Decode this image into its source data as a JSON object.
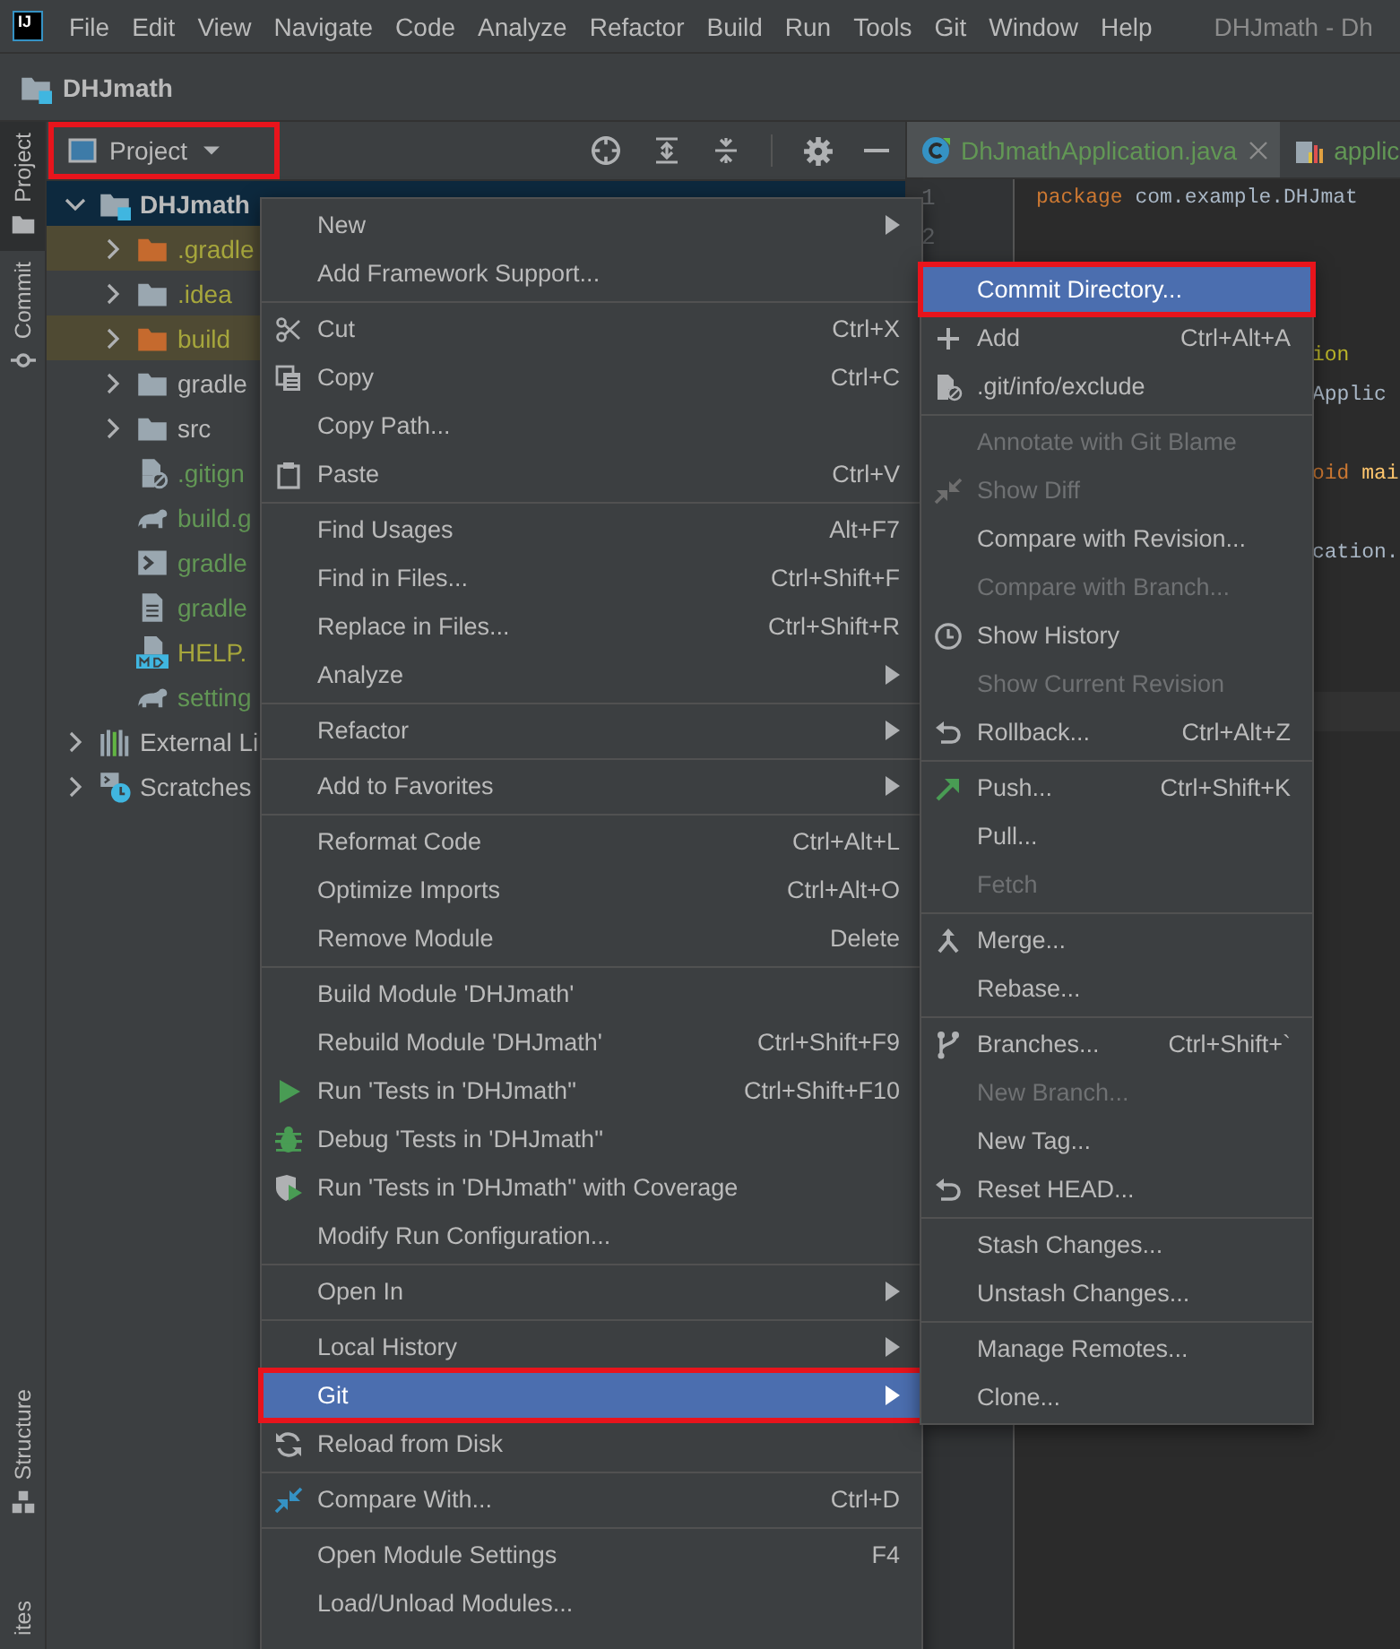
{
  "menu_bar": {
    "logo": "IJ",
    "items": [
      "File",
      "Edit",
      "View",
      "Navigate",
      "Code",
      "Analyze",
      "Refactor",
      "Build",
      "Run",
      "Tools",
      "Git",
      "Window",
      "Help"
    ],
    "title": "DHJmath - Dh"
  },
  "nav_bar": {
    "project": "DHJmath"
  },
  "tool_strip": {
    "top": [
      {
        "label": "Project",
        "kind": "project",
        "selected": true
      },
      {
        "label": "Commit",
        "kind": "commit",
        "selected": false
      }
    ],
    "bottom": [
      {
        "label": "Structure",
        "kind": "structure"
      },
      {
        "label": "ites",
        "kind": "favorites"
      }
    ]
  },
  "project_panel": {
    "view": {
      "label": "Project",
      "marked": true
    },
    "tree": [
      {
        "label": "DHJmath",
        "kind": "module",
        "color": "#bbbbbb",
        "selected": true,
        "excluded": false,
        "expanded": true,
        "children": [
          {
            "label": ".gradle",
            "kind": "folder",
            "color": "#a6a63c",
            "selected": false,
            "excluded": true,
            "expanded": false
          },
          {
            "label": ".idea",
            "kind": "folder",
            "color": "#a6a63c",
            "selected": false,
            "excluded": false,
            "expanded": false
          },
          {
            "label": "build",
            "kind": "folder",
            "color": "#a6a63c",
            "selected": false,
            "excluded": true,
            "expanded": false
          },
          {
            "label": "gradle",
            "kind": "folder",
            "color": "#bbbbbb",
            "selected": false,
            "excluded": false,
            "expanded": false
          },
          {
            "label": "src",
            "kind": "folder",
            "color": "#bbbbbb",
            "selected": false,
            "excluded": false,
            "expanded": false
          },
          {
            "label": ".gitign",
            "kind": "ignore-file",
            "color": "#629755",
            "selected": false,
            "excluded": false
          },
          {
            "label": "build.g",
            "kind": "gradle-script",
            "color": "#629755",
            "selected": false,
            "excluded": false
          },
          {
            "label": "gradle",
            "kind": "shell-script",
            "color": "#629755",
            "selected": false,
            "excluded": false
          },
          {
            "label": "gradle",
            "kind": "text-file",
            "color": "#629755",
            "selected": false,
            "excluded": false
          },
          {
            "label": "HELP.",
            "kind": "markdown-file",
            "color": "#a6a63c",
            "selected": false,
            "excluded": false
          },
          {
            "label": "setting",
            "kind": "gradle-script",
            "color": "#629755",
            "selected": false,
            "excluded": false
          }
        ]
      },
      {
        "label": "External Li",
        "kind": "libraries",
        "color": "#bbbbbb",
        "selected": false,
        "excluded": false,
        "expanded": false
      },
      {
        "label": "Scratches",
        "kind": "scratches",
        "color": "#bbbbbb",
        "selected": false,
        "excluded": false,
        "expanded": false
      }
    ]
  },
  "editor": {
    "tabs": [
      {
        "label": "DhJmathApplication.java",
        "kind": "class",
        "selected": true,
        "closable": true
      },
      {
        "label": "applic",
        "kind": "properties",
        "selected": false,
        "closable": false
      }
    ],
    "line_numbers": [
      "1",
      "2"
    ],
    "lines": [
      {
        "kind": "full",
        "tokens": [
          {
            "text": "package",
            "kind": "keyword"
          },
          {
            "text": " com.example.DHJmat",
            "kind": "plain"
          }
        ]
      },
      {
        "kind": "blank"
      },
      {
        "kind": "blank"
      },
      {
        "kind": "blank"
      },
      {
        "kind": "clipped",
        "tokens": [
          {
            "text": "ion",
            "kind": "annotation"
          }
        ]
      },
      {
        "kind": "clipped",
        "tokens": [
          {
            "text": "Applic",
            "kind": "plain"
          }
        ]
      },
      {
        "kind": "blank"
      },
      {
        "kind": "clipped",
        "tokens": [
          {
            "text": "oid",
            "kind": "keyword"
          },
          {
            "text": " mai",
            "kind": "method"
          }
        ]
      },
      {
        "kind": "blank"
      },
      {
        "kind": "clipped",
        "tokens": [
          {
            "text": "cation.",
            "kind": "plain"
          }
        ]
      },
      {
        "kind": "blank"
      },
      {
        "kind": "blank"
      },
      {
        "kind": "blank"
      },
      {
        "kind": "current"
      }
    ]
  },
  "context_menu": {
    "items": [
      {
        "kind": "item",
        "label": "New",
        "submenu": true,
        "selected": false,
        "marked": false
      },
      {
        "kind": "item",
        "label": "Add Framework Support...",
        "submenu": false,
        "selected": false,
        "marked": false
      },
      {
        "kind": "separator"
      },
      {
        "kind": "cut",
        "label": "Cut",
        "shortcut": "Ctrl+X",
        "submenu": false,
        "selected": false,
        "marked": false
      },
      {
        "kind": "copy",
        "label": "Copy",
        "shortcut": "Ctrl+C",
        "submenu": false,
        "selected": false,
        "marked": false
      },
      {
        "kind": "item",
        "label": "Copy Path...",
        "submenu": false,
        "selected": false,
        "marked": false
      },
      {
        "kind": "paste",
        "label": "Paste",
        "shortcut": "Ctrl+V",
        "submenu": false,
        "selected": false,
        "marked": false
      },
      {
        "kind": "separator"
      },
      {
        "kind": "item",
        "label": "Find Usages",
        "shortcut": "Alt+F7",
        "submenu": false,
        "selected": false,
        "marked": false
      },
      {
        "kind": "item",
        "label": "Find in Files...",
        "shortcut": "Ctrl+Shift+F",
        "submenu": false,
        "selected": false,
        "marked": false
      },
      {
        "kind": "item",
        "label": "Replace in Files...",
        "shortcut": "Ctrl+Shift+R",
        "submenu": false,
        "selected": false,
        "marked": false
      },
      {
        "kind": "item",
        "label": "Analyze",
        "submenu": true,
        "selected": false,
        "marked": false
      },
      {
        "kind": "separator"
      },
      {
        "kind": "item",
        "label": "Refactor",
        "submenu": true,
        "selected": false,
        "marked": false
      },
      {
        "kind": "separator"
      },
      {
        "kind": "item",
        "label": "Add to Favorites",
        "submenu": true,
        "selected": false,
        "marked": false
      },
      {
        "kind": "separator"
      },
      {
        "kind": "item",
        "label": "Reformat Code",
        "shortcut": "Ctrl+Alt+L",
        "submenu": false,
        "selected": false,
        "marked": false
      },
      {
        "kind": "item",
        "label": "Optimize Imports",
        "shortcut": "Ctrl+Alt+O",
        "submenu": false,
        "selected": false,
        "marked": false
      },
      {
        "kind": "item",
        "label": "Remove Module",
        "shortcut": "Delete",
        "submenu": false,
        "selected": false,
        "marked": false
      },
      {
        "kind": "separator"
      },
      {
        "kind": "item",
        "label": "Build Module 'DHJmath'",
        "submenu": false,
        "selected": false,
        "marked": false
      },
      {
        "kind": "item",
        "label": "Rebuild Module 'DHJmath'",
        "shortcut": "Ctrl+Shift+F9",
        "submenu": false,
        "selected": false,
        "marked": false
      },
      {
        "kind": "run",
        "label": "Run 'Tests in 'DHJmath''",
        "shortcut": "Ctrl+Shift+F10",
        "submenu": false,
        "selected": false,
        "marked": false
      },
      {
        "kind": "debug",
        "label": "Debug 'Tests in 'DHJmath''",
        "submenu": false,
        "selected": false,
        "marked": false
      },
      {
        "kind": "coverage",
        "label": "Run 'Tests in 'DHJmath'' with Coverage",
        "submenu": false,
        "selected": false,
        "marked": false
      },
      {
        "kind": "item",
        "label": "Modify Run Configuration...",
        "submenu": false,
        "selected": false,
        "marked": false
      },
      {
        "kind": "separator"
      },
      {
        "kind": "item",
        "label": "Open In",
        "submenu": true,
        "selected": false,
        "marked": false
      },
      {
        "kind": "separator"
      },
      {
        "kind": "item",
        "label": "Local History",
        "submenu": true,
        "selected": false,
        "marked": false
      },
      {
        "kind": "item",
        "label": "Git",
        "submenu": true,
        "selected": true,
        "marked": true
      },
      {
        "kind": "reload",
        "label": "Reload from Disk",
        "submenu": false,
        "selected": false,
        "marked": false
      },
      {
        "kind": "separator"
      },
      {
        "kind": "compare",
        "label": "Compare With...",
        "shortcut": "Ctrl+D",
        "submenu": false,
        "selected": false,
        "marked": false
      },
      {
        "kind": "separator"
      },
      {
        "kind": "item",
        "label": "Open Module Settings",
        "shortcut": "F4",
        "submenu": false,
        "selected": false,
        "marked": false
      },
      {
        "kind": "item",
        "label": "Load/Unload Modules...",
        "submenu": false,
        "selected": false,
        "marked": false
      }
    ]
  },
  "git_submenu": {
    "items": [
      {
        "kind": "item",
        "label": "Commit Directory...",
        "disabled": false,
        "selected": true,
        "marked": true
      },
      {
        "kind": "add",
        "label": "Add",
        "shortcut": "Ctrl+Alt+A",
        "disabled": false,
        "selected": false,
        "marked": false
      },
      {
        "kind": "exclude",
        "label": ".git/info/exclude",
        "disabled": false,
        "selected": false,
        "marked": false
      },
      {
        "kind": "separator"
      },
      {
        "kind": "item",
        "label": "Annotate with Git Blame",
        "disabled": true,
        "selected": false,
        "marked": false
      },
      {
        "kind": "diff",
        "label": "Show Diff",
        "disabled": true,
        "selected": false,
        "marked": false
      },
      {
        "kind": "item",
        "label": "Compare with Revision...",
        "disabled": false,
        "selected": false,
        "marked": false
      },
      {
        "kind": "item",
        "label": "Compare with Branch...",
        "disabled": true,
        "selected": false,
        "marked": false
      },
      {
        "kind": "history",
        "label": "Show History",
        "disabled": false,
        "selected": false,
        "marked": false
      },
      {
        "kind": "item",
        "label": "Show Current Revision",
        "disabled": true,
        "selected": false,
        "marked": false
      },
      {
        "kind": "rollback",
        "label": "Rollback...",
        "shortcut": "Ctrl+Alt+Z",
        "disabled": false,
        "selected": false,
        "marked": false
      },
      {
        "kind": "separator"
      },
      {
        "kind": "push",
        "label": "Push...",
        "shortcut": "Ctrl+Shift+K",
        "disabled": false,
        "selected": false,
        "marked": false
      },
      {
        "kind": "item",
        "label": "Pull...",
        "disabled": false,
        "selected": false,
        "marked": false
      },
      {
        "kind": "item",
        "label": "Fetch",
        "disabled": true,
        "selected": false,
        "marked": false
      },
      {
        "kind": "separator"
      },
      {
        "kind": "merge",
        "label": "Merge...",
        "disabled": false,
        "selected": false,
        "marked": false
      },
      {
        "kind": "item",
        "label": "Rebase...",
        "disabled": false,
        "selected": false,
        "marked": false
      },
      {
        "kind": "separator"
      },
      {
        "kind": "branches",
        "label": "Branches...",
        "shortcut": "Ctrl+Shift+`",
        "disabled": false,
        "selected": false,
        "marked": false
      },
      {
        "kind": "item",
        "label": "New Branch...",
        "disabled": true,
        "selected": false,
        "marked": false
      },
      {
        "kind": "item",
        "label": "New Tag...",
        "disabled": false,
        "selected": false,
        "marked": false
      },
      {
        "kind": "rollback",
        "label": "Reset HEAD...",
        "disabled": false,
        "selected": false,
        "marked": false
      },
      {
        "kind": "separator"
      },
      {
        "kind": "item",
        "label": "Stash Changes...",
        "disabled": false,
        "selected": false,
        "marked": false
      },
      {
        "kind": "item",
        "label": "Unstash Changes...",
        "disabled": false,
        "selected": false,
        "marked": false
      },
      {
        "kind": "separator"
      },
      {
        "kind": "item",
        "label": "Manage Remotes...",
        "disabled": false,
        "selected": false,
        "marked": false
      },
      {
        "kind": "item",
        "label": "Clone...",
        "disabled": false,
        "selected": false,
        "marked": false
      }
    ]
  }
}
